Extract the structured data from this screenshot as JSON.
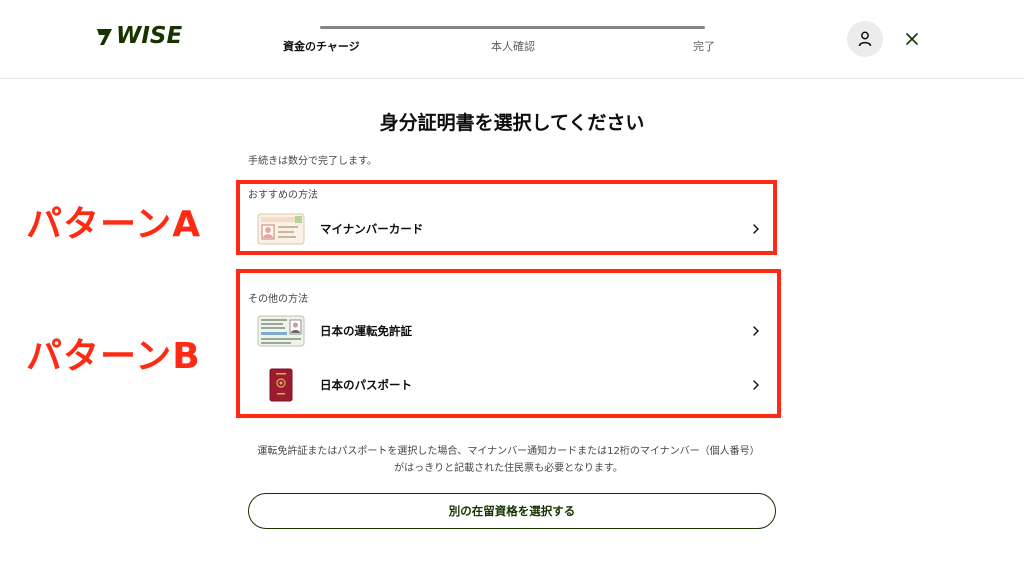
{
  "header": {
    "logo_text": "WISE",
    "steps": [
      "資金のチャージ",
      "本人確認",
      "完了"
    ],
    "avatar_icon": "person-icon",
    "close_icon": "close-icon"
  },
  "main": {
    "title": "身分証明書を選択してください",
    "subtitle": "手続きは数分で完了します。",
    "recommended": {
      "label": "おすすめの方法",
      "options": [
        {
          "label": "マイナンバーカード",
          "icon": "mynumber-card-icon"
        }
      ]
    },
    "other": {
      "label": "その他の方法",
      "options": [
        {
          "label": "日本の運転免許証",
          "icon": "drivers-license-icon"
        },
        {
          "label": "日本のパスポート",
          "icon": "passport-icon"
        }
      ]
    },
    "note_line1": "運転免許証またはパスポートを選択した場合、マイナンバー通知カードまたは12桁のマイナンバー（個人番号）",
    "note_line2": "がはっきりと記載された住民票も必要となります。",
    "cta_label": "別の在留資格を選択する"
  },
  "annotations": {
    "pattern_a": "パターンA",
    "pattern_b": "パターンB"
  },
  "colors": {
    "brand": "#163300",
    "annotation_red": "#ff2a14",
    "track": "#868685"
  }
}
